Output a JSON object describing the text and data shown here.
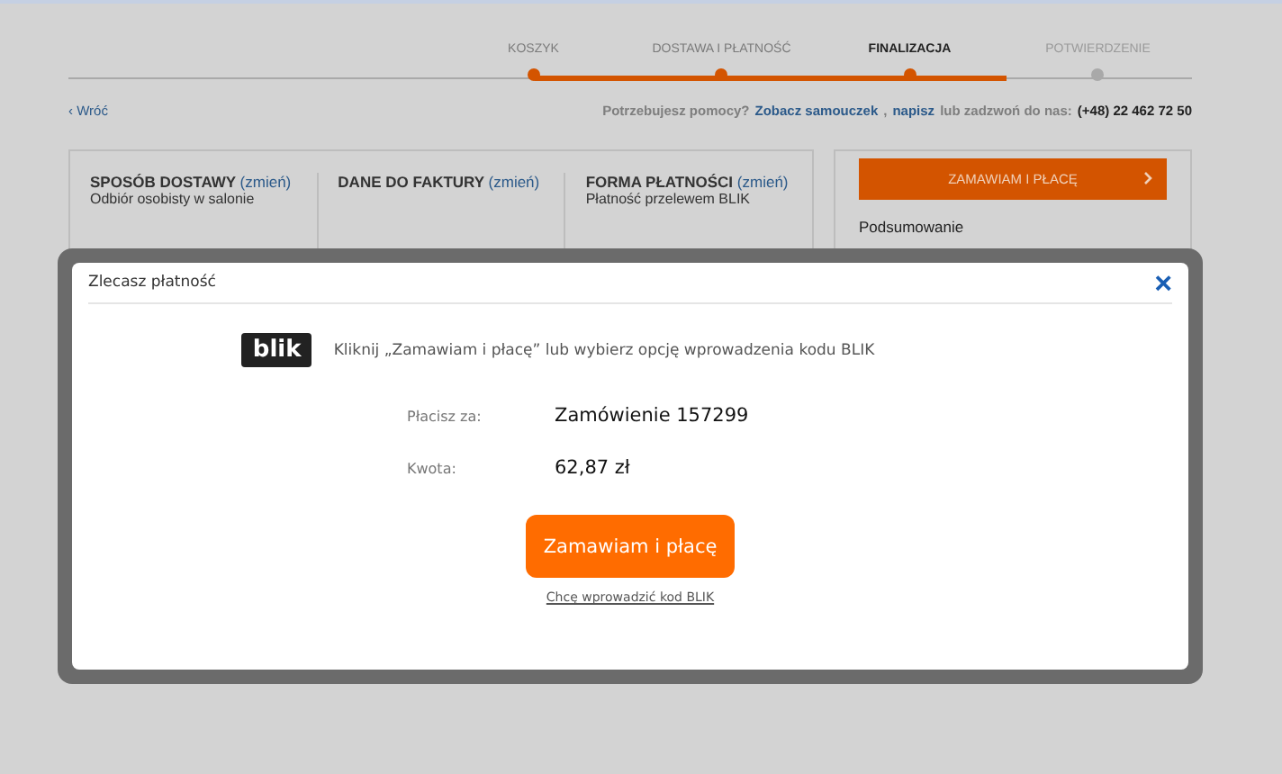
{
  "steps": [
    {
      "label": "KOSZYK",
      "completed": true,
      "selected": false
    },
    {
      "label": "DOSTAWA I PŁATNOŚĆ",
      "completed": true,
      "selected": false
    },
    {
      "label": "FINALIZACJA",
      "completed": false,
      "selected": true
    },
    {
      "label": "POTWIERDZENIE",
      "completed": false,
      "selected": false
    }
  ],
  "back_link": "‹ Wróć",
  "help": [
    {
      "text": "Potrzebujesz pomocy?",
      "kind": "muted"
    },
    {
      "text": "Zobacz samouczek",
      "kind": "link"
    },
    {
      "text": ",",
      "kind": "muted"
    },
    {
      "text": "napisz",
      "kind": "link"
    },
    {
      "text": "lub zadzwoń do nas:",
      "kind": "muted"
    },
    {
      "text": "(+48) 22 462 72 50",
      "kind": "strong"
    }
  ],
  "summary_sections": [
    {
      "title": "SPOSÓB DOSTAWY",
      "change": "(zmień)",
      "value": "Odbiór osobisty w salonie"
    },
    {
      "title": "DANE DO FAKTURY",
      "change": "(zmień)"
    },
    {
      "title": "FORMA PŁATNOŚCI",
      "change": "(zmień)",
      "value": "Płatność przelewem BLIK"
    }
  ],
  "order_button": "ZAMAWIAM I PŁACĘ",
  "summary_heading": "Podsumowanie",
  "modal": {
    "title": "Zlecasz płatność",
    "close": "×",
    "logo": "blik",
    "instruction": "Kliknij „Zamawiam i płacę” lub wybierz opcję wprowadzenia kodu BLIK",
    "fields": [
      {
        "label": "Płacisz za:",
        "value": "Zamówienie 157299"
      },
      {
        "label": "Kwota:",
        "value": "62,87 zł"
      }
    ],
    "confirm_button": "Zamawiam i płacę",
    "code_link": "Chcę wprowadzić kod BLIK"
  }
}
